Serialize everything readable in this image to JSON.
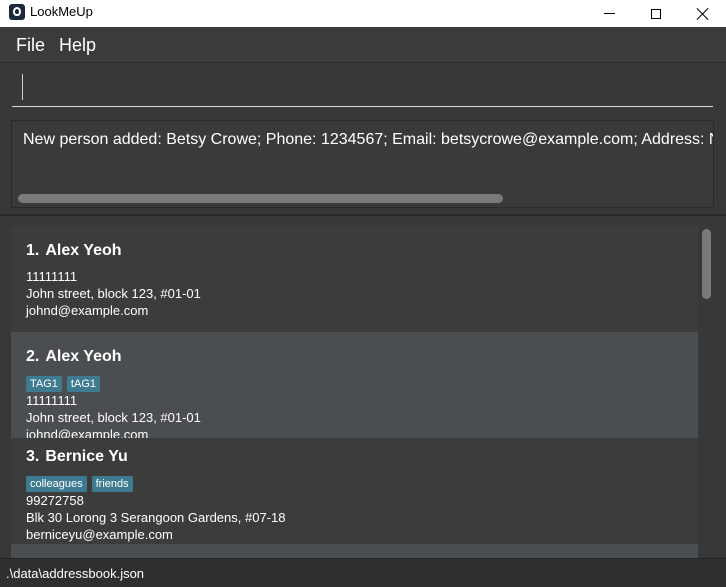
{
  "window": {
    "title": "LookMeUp"
  },
  "menu": {
    "file": "File",
    "help": "Help"
  },
  "command": {
    "value": "",
    "placeholder": ""
  },
  "result": {
    "text": "New person added: Betsy Crowe; Phone: 1234567; Email: betsycrowe@example.com; Address: Newgate Prison"
  },
  "persons": [
    {
      "index": "1.",
      "name": "Alex Yeoh",
      "tags": [],
      "phone": "11111111",
      "address": "John street, block 123, #01-01",
      "email": "johnd@example.com"
    },
    {
      "index": "2.",
      "name": "Alex Yeoh",
      "tags": [
        "TAG1",
        "tAG1"
      ],
      "phone": "11111111",
      "address": "John street, block 123, #01-01",
      "email": "johnd@example.com"
    },
    {
      "index": "3.",
      "name": "Bernice Yu",
      "tags": [
        "colleagues",
        "friends"
      ],
      "phone": "99272758",
      "address": "Blk 30 Lorong 3 Serangoon Gardens, #07-18",
      "email": "berniceyu@example.com"
    }
  ],
  "status": {
    "path": ".\\data\\addressbook.json"
  },
  "colors": {
    "background": "#383838",
    "tag": "#3e7b91",
    "selected_card": "#4a4e50"
  }
}
